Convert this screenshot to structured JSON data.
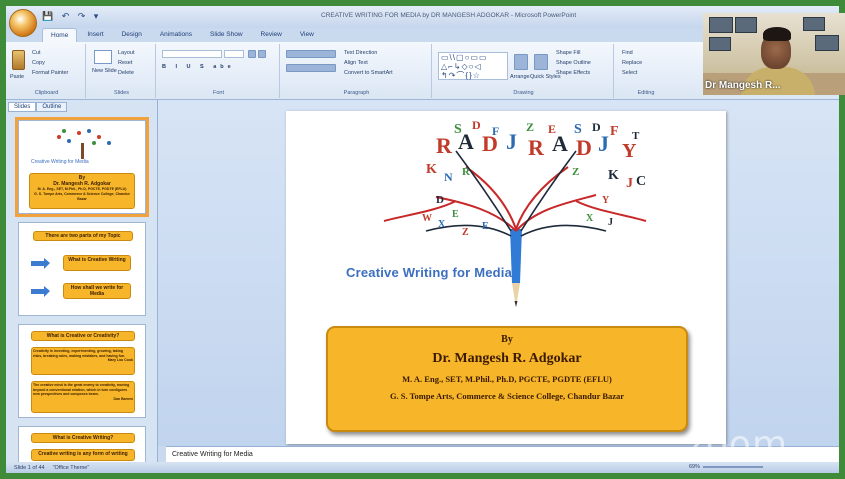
{
  "window": {
    "title": "CREATIVE WRITING FOR MEDIA by DR MANGESH ADGOKAR - Microsoft PowerPoint",
    "qat": "💾 ↶ ↷ ▾"
  },
  "ribbon_tabs": [
    "Home",
    "Insert",
    "Design",
    "Animations",
    "Slide Show",
    "Review",
    "View"
  ],
  "ribbon": {
    "clipboard": {
      "paste": "Paste",
      "cut": "Cut",
      "copy": "Copy",
      "format_painter": "Format Painter",
      "label": "Clipboard"
    },
    "slides": {
      "new_slide": "New Slide",
      "layout": "Layout",
      "reset": "Reset",
      "delete": "Delete",
      "label": "Slides"
    },
    "font": {
      "label": "Font"
    },
    "paragraph": {
      "text_direction": "Text Direction",
      "align_text": "Align Text",
      "smartart": "Convert to SmartArt",
      "label": "Paragraph"
    },
    "drawing": {
      "arrange": "Arrange",
      "quick_styles": "Quick Styles",
      "shape_fill": "Shape Fill",
      "shape_outline": "Shape Outline",
      "shape_effects": "Shape Effects",
      "label": "Drawing"
    },
    "editing": {
      "find": "Find",
      "replace": "Replace",
      "select": "Select",
      "label": "Editing"
    }
  },
  "panel": {
    "tabs": [
      "Slides",
      "Outline"
    ],
    "slides": [
      {
        "num": "1",
        "caption": "Creative Writing for Media",
        "by": "By",
        "name": "Dr. Mangesh R. Adgokar",
        "deg": "M. A. Eng., SET, M.Phil., Ph.D, PGCTE, PGDTE (EFLU)",
        "college": "G. S. Tompe Arts, Commerce & Science College, Chandur Bazar"
      },
      {
        "num": "2",
        "title": "There are two parts of my Topic",
        "item1": "What is Creative Writing",
        "item2": "How shall we write for Media"
      },
      {
        "num": "3",
        "title": "What is Creative or Creativity?",
        "q1": "Creativity is inventing, experimenting, growing, taking risks, breaking rules, making mistakes, and having fun.",
        "a1": "Mary Lou Cook",
        "q2": "The creative mind is the great enemy to creativity, moving beyond a conventional relation, which in turn configures new perspectives and composes bears.",
        "a2": "Dan Barnes"
      },
      {
        "num": "4",
        "title": "What is Creative Writing?",
        "line": "Creative writing is any form of writing"
      }
    ]
  },
  "slide": {
    "title": "Creative Writing for Media",
    "by": "By",
    "author": "Dr. Mangesh R. Adgokar",
    "degrees": "M. A. Eng., SET, M.Phil., Ph.D, PGCTE, PGDTE (EFLU)",
    "college": "G. S. Tompe Arts, Commerce & Science College, Chandur Bazar"
  },
  "notes": "Creative Writing for Media",
  "status": {
    "slide": "Slide 1 of 44",
    "theme": "\"Office Theme\"",
    "zoom": "69%"
  },
  "video": {
    "name": "Dr Mangesh R..."
  },
  "zoom_logo": "zoom"
}
